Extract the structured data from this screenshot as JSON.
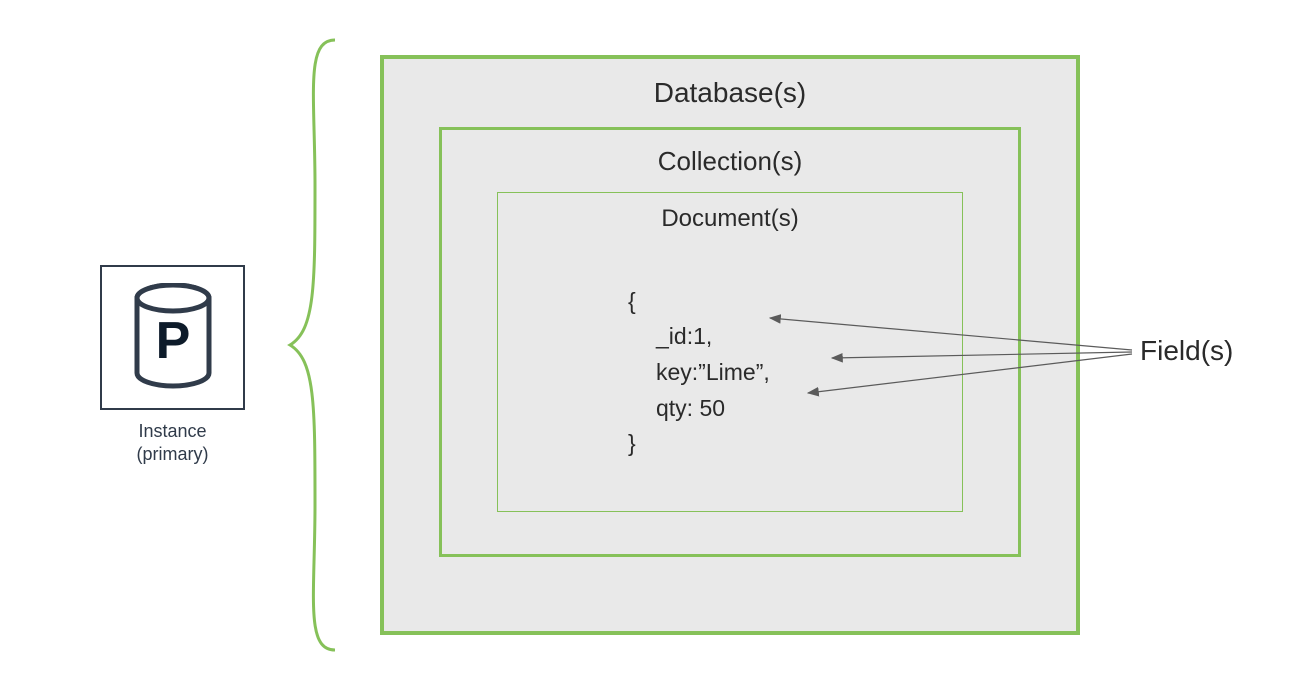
{
  "instance": {
    "letter": "P",
    "caption_line1": "Instance",
    "caption_line2": "(primary)"
  },
  "boxes": {
    "database_label": "Database(s)",
    "collection_label": "Collection(s)",
    "document_label": "Document(s)"
  },
  "document_fields": {
    "open_brace": "{",
    "line1": "_id:1,",
    "line2": "key:”Lime”,",
    "line3": "qty: 50",
    "close_brace": "}"
  },
  "fields_label": "Field(s)"
}
